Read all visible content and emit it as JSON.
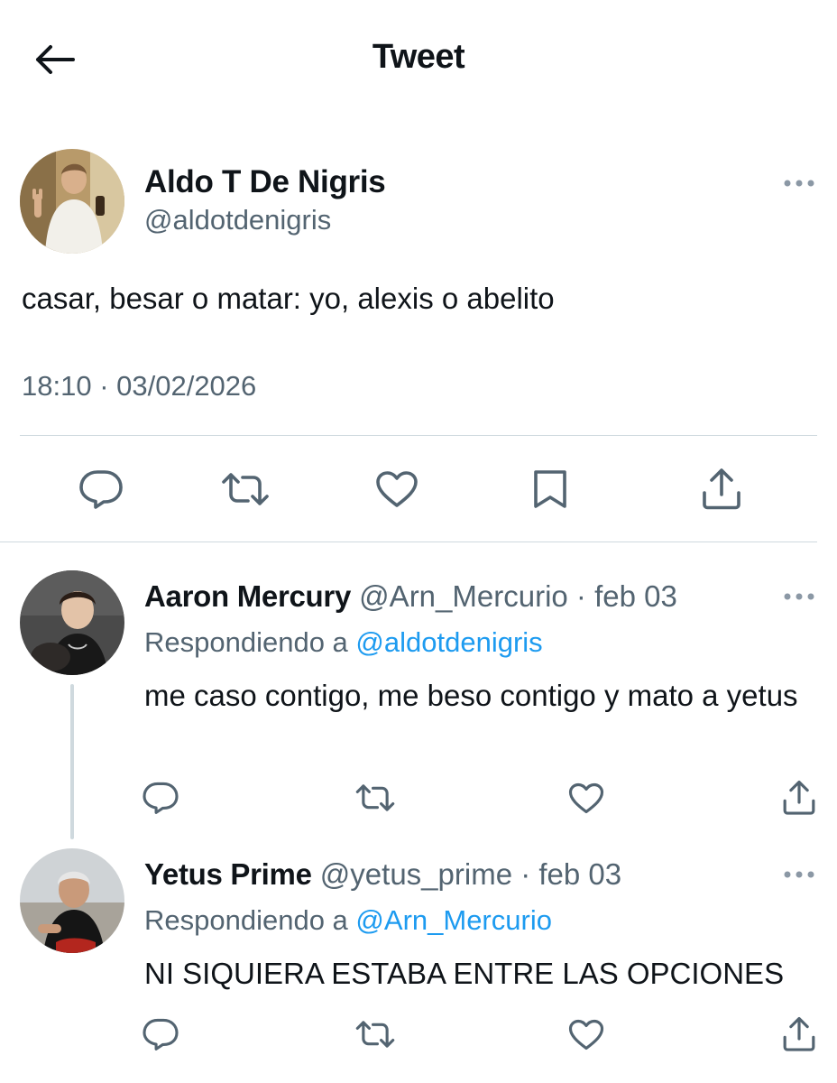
{
  "header": {
    "title": "Tweet",
    "back_icon": "arrow-left-icon"
  },
  "main_tweet": {
    "author_name": "Aldo T De Nigris",
    "author_handle": "@aldotdenigris",
    "text": "casar, besar o matar: yo, alexis o abelito",
    "timestamp": "18:10 · 03/02/2026",
    "actions": [
      "reply-icon",
      "retweet-icon",
      "like-icon",
      "bookmark-icon",
      "share-icon"
    ]
  },
  "replies": [
    {
      "author_name": "Aaron Mercury",
      "meta": " @Arn_Mercurio · feb 03",
      "replying_prefix": "Respondiendo a ",
      "replying_to": "@aldotdenigris",
      "text": "me caso contigo, me beso contigo y mato a yetus"
    },
    {
      "author_name": "Yetus Prime",
      "meta": " @yetus_prime · feb 03",
      "replying_prefix": "Respondiendo a ",
      "replying_to": "@Arn_Mercurio",
      "text": "NI SIQUIERA ESTABA ENTRE LAS OPCIONES"
    }
  ],
  "colors": {
    "text": "#0f1419",
    "secondary": "#536471",
    "link": "#1d9bf0",
    "divider": "#cfd9de"
  }
}
